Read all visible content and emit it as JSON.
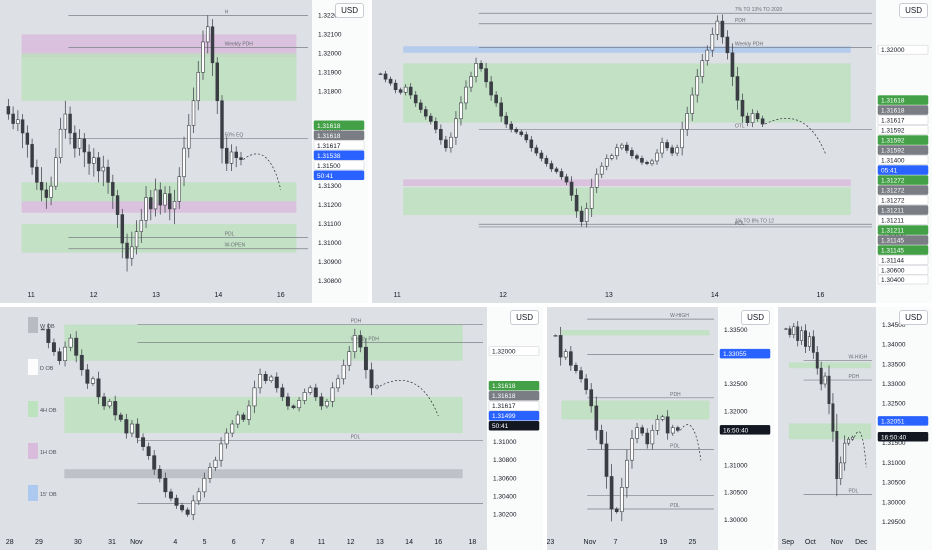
{
  "colors": {
    "background": "#dde0e5",
    "separator": "#ffffff",
    "candle_body": "#3a3d44",
    "candle_wick": "#4a4d55",
    "ob_green": "#b9e2b9",
    "ob_pink": "#d8b7d9",
    "ob_gray": "#b4b7bd",
    "ob_blue": "#a8c6ef",
    "badge_green": "#43a047",
    "badge_gray": "#7a7d84",
    "badge_blue": "#2962ff",
    "badge_black": "#131722",
    "badge_white": "#ffffff"
  },
  "chart_data": [
    {
      "id": "p1",
      "type": "candlestick",
      "currency": "USD",
      "ylim": [
        1.308,
        1.3226
      ],
      "yticks": [
        "1.32200",
        "1.32100",
        "1.32000",
        "1.31900",
        "1.31800",
        "1.31600",
        "1.31400",
        "1.31300",
        "1.31200",
        "1.31100",
        "1.31000",
        "1.30900",
        "1.30800"
      ],
      "xticks": [
        {
          "label": "11",
          "pos": 0.1
        },
        {
          "label": "12",
          "pos": 0.3
        },
        {
          "label": "13",
          "pos": 0.5
        },
        {
          "label": "14",
          "pos": 0.7
        },
        {
          "label": "16",
          "pos": 0.9
        }
      ],
      "candles": [
        [
          1.3172,
          1.3168,
          1.3176,
          1.3165
        ],
        [
          1.3168,
          1.3163,
          1.3172,
          1.316
        ],
        [
          1.3163,
          1.3165,
          1.317,
          1.3159
        ],
        [
          1.3165,
          1.3158,
          1.3168,
          1.315
        ],
        [
          1.3158,
          1.3152,
          1.3162,
          1.3145
        ],
        [
          1.3152,
          1.314,
          1.3155,
          1.3136
        ],
        [
          1.314,
          1.3132,
          1.3144,
          1.3128
        ],
        [
          1.3132,
          1.3128,
          1.314,
          1.3122
        ],
        [
          1.3128,
          1.3124,
          1.3132,
          1.3118
        ],
        [
          1.3124,
          1.313,
          1.3135,
          1.312
        ],
        [
          1.313,
          1.3145,
          1.315,
          1.3128
        ],
        [
          1.3145,
          1.316,
          1.3166,
          1.3142
        ],
        [
          1.316,
          1.3168,
          1.3175,
          1.3155
        ],
        [
          1.3168,
          1.3158,
          1.3172,
          1.3152
        ],
        [
          1.3158,
          1.315,
          1.3162,
          1.3145
        ],
        [
          1.315,
          1.3155,
          1.316,
          1.3146
        ],
        [
          1.3155,
          1.3148,
          1.3158,
          1.314
        ],
        [
          1.3148,
          1.3142,
          1.3152,
          1.3136
        ],
        [
          1.3142,
          1.3145,
          1.315,
          1.3135
        ],
        [
          1.3145,
          1.3138,
          1.3148,
          1.3132
        ],
        [
          1.3138,
          1.314,
          1.3146,
          1.313
        ],
        [
          1.314,
          1.3132,
          1.3144,
          1.3126
        ],
        [
          1.3132,
          1.3125,
          1.3136,
          1.3118
        ],
        [
          1.3125,
          1.3115,
          1.3128,
          1.3108
        ],
        [
          1.3115,
          1.31,
          1.3118,
          1.3092
        ],
        [
          1.31,
          1.3092,
          1.3105,
          1.3085
        ],
        [
          1.3092,
          1.3098,
          1.3106,
          1.3088
        ],
        [
          1.3098,
          1.3106,
          1.3112,
          1.3094
        ],
        [
          1.3106,
          1.3112,
          1.3118,
          1.31
        ],
        [
          1.3112,
          1.3124,
          1.313,
          1.3108
        ],
        [
          1.3124,
          1.3118,
          1.3128,
          1.3112
        ],
        [
          1.3118,
          1.3128,
          1.3134,
          1.3114
        ],
        [
          1.3128,
          1.312,
          1.3132,
          1.3115
        ],
        [
          1.312,
          1.3126,
          1.313,
          1.3116
        ],
        [
          1.3126,
          1.3118,
          1.313,
          1.3112
        ],
        [
          1.3118,
          1.3122,
          1.3128,
          1.311
        ],
        [
          1.3122,
          1.3135,
          1.314,
          1.3118
        ],
        [
          1.3135,
          1.315,
          1.3156,
          1.313
        ],
        [
          1.315,
          1.3162,
          1.3168,
          1.3145
        ],
        [
          1.3162,
          1.3175,
          1.3182,
          1.3158
        ],
        [
          1.3175,
          1.319,
          1.3196,
          1.317
        ],
        [
          1.319,
          1.3206,
          1.3212,
          1.3186
        ],
        [
          1.3206,
          1.3214,
          1.322,
          1.32
        ],
        [
          1.3214,
          1.3195,
          1.3218,
          1.3188
        ],
        [
          1.3195,
          1.3175,
          1.3198,
          1.3168
        ],
        [
          1.3175,
          1.315,
          1.3178,
          1.3142
        ],
        [
          1.315,
          1.3142,
          1.3156,
          1.3138
        ],
        [
          1.3142,
          1.3148,
          1.3152,
          1.3138
        ],
        [
          1.3148,
          1.3145,
          1.3151,
          1.314
        ],
        [
          1.3145,
          1.3144,
          1.3148,
          1.3141
        ]
      ],
      "zones": [
        {
          "y1": 1.3198,
          "y2": 1.321,
          "kind": "pink"
        },
        {
          "y1": 1.3175,
          "y2": 1.32,
          "kind": "green"
        },
        {
          "y1": 1.3116,
          "y2": 1.3122,
          "kind": "pink"
        },
        {
          "y1": 1.3122,
          "y2": 1.3132,
          "kind": "green"
        },
        {
          "y1": 1.3095,
          "y2": 1.311,
          "kind": "green"
        }
      ],
      "levels": [
        {
          "y": 1.322,
          "label": "H"
        },
        {
          "y": 1.3203,
          "label": "Weekly PDH"
        },
        {
          "y": 1.3155,
          "label": "50% EQ"
        },
        {
          "y": 1.3103,
          "label": "PDL"
        },
        {
          "y": 1.3097,
          "label": "W-OPEN"
        }
      ],
      "badges": [
        {
          "text": "1.31618",
          "color": "badge_green",
          "price": 1.31618
        },
        {
          "text": "1.31618",
          "color": "badge_gray",
          "price": 1.31618
        },
        {
          "text": "1.31617",
          "color": "badge_white",
          "price": 1.31617
        },
        {
          "text": "1.31538",
          "color": "badge_blue",
          "price": 1.31538
        },
        {
          "text": "1.31500",
          "color": "badge_white",
          "price": 1.315
        },
        {
          "text": "50:41",
          "color": "badge_blue",
          "price": 1.315
        }
      ]
    },
    {
      "id": "p2",
      "type": "candlestick",
      "currency": "USD",
      "ylim": [
        1.3025,
        1.3235
      ],
      "yticks": [
        "1.32000",
        "1.31400",
        "1.30600",
        "1.30400"
      ],
      "xticks": [
        {
          "label": "11",
          "pos": 0.05
        },
        {
          "label": "12",
          "pos": 0.26
        },
        {
          "label": "13",
          "pos": 0.47
        },
        {
          "label": "14",
          "pos": 0.68
        },
        {
          "label": "16",
          "pos": 0.89
        }
      ],
      "close": [
        1.3182,
        1.3178,
        1.3175,
        1.317,
        1.3168,
        1.3172,
        1.3166,
        1.316,
        1.3155,
        1.315,
        1.3146,
        1.314,
        1.3132,
        1.3126,
        1.3134,
        1.3148,
        1.316,
        1.3172,
        1.318,
        1.319,
        1.3186,
        1.3176,
        1.3166,
        1.316,
        1.315,
        1.3144,
        1.314,
        1.3138,
        1.3136,
        1.3132,
        1.3126,
        1.3122,
        1.3118,
        1.3114,
        1.311,
        1.3108,
        1.3104,
        1.31,
        1.309,
        1.3078,
        1.307,
        1.308,
        1.3096,
        1.3106,
        1.3112,
        1.3118,
        1.312,
        1.3126,
        1.3128,
        1.3124,
        1.312,
        1.3118,
        1.3115,
        1.3114,
        1.3116,
        1.3122,
        1.313,
        1.3126,
        1.3122,
        1.3126,
        1.314,
        1.3152,
        1.3166,
        1.318,
        1.3192,
        1.32,
        1.3212,
        1.3222,
        1.321,
        1.3198,
        1.318,
        1.3162,
        1.315,
        1.3145,
        1.3152,
        1.3148,
        1.3144
      ],
      "zones": [
        {
          "y1": 1.3198,
          "y2": 1.3203,
          "kind": "blue"
        },
        {
          "y1": 1.3145,
          "y2": 1.319,
          "kind": "green"
        },
        {
          "y1": 1.3097,
          "y2": 1.3102,
          "kind": "pink"
        },
        {
          "y1": 1.3075,
          "y2": 1.3096,
          "kind": "green"
        }
      ],
      "levels": [
        {
          "y": 1.3228,
          "label": "7% TO 13% TO 2020"
        },
        {
          "y": 1.322,
          "label": "PDH"
        },
        {
          "y": 1.3202,
          "label": "Weekly PDH"
        },
        {
          "y": 1.314,
          "label": "OTL"
        },
        {
          "y": 1.3068,
          "label": "1% TO 8% TO 12"
        },
        {
          "y": 1.3066,
          "label": "PDL"
        }
      ],
      "badges": [
        {
          "text": "1.32000",
          "color": "badge_white",
          "price": 1.32
        },
        {
          "text": "1.31618",
          "color": "badge_green",
          "price": 1.31618
        },
        {
          "text": "1.31618",
          "color": "badge_gray",
          "price": 1.31618
        },
        {
          "text": "1.31617",
          "color": "badge_white",
          "price": 1.31617
        },
        {
          "text": "1.31592",
          "color": "badge_white",
          "price": 1.31592
        },
        {
          "text": "1.31592",
          "color": "badge_green",
          "price": 1.31592
        },
        {
          "text": "1.31592",
          "color": "badge_gray",
          "price": 1.31592
        },
        {
          "text": "1.31400",
          "color": "badge_white",
          "price": 1.314
        },
        {
          "text": "05:41",
          "color": "badge_blue",
          "price": 1.3141
        },
        {
          "text": "1.31272",
          "color": "badge_green",
          "price": 1.31272
        },
        {
          "text": "1.31272",
          "color": "badge_gray",
          "price": 1.31272
        },
        {
          "text": "1.31272",
          "color": "badge_white",
          "price": 1.31272
        },
        {
          "text": "1.31211",
          "color": "badge_gray",
          "price": 1.31211
        },
        {
          "text": "1.31211",
          "color": "badge_white",
          "price": 1.31211
        },
        {
          "text": "1.31211",
          "color": "badge_green",
          "price": 1.31211
        },
        {
          "text": "1.31145",
          "color": "badge_gray",
          "price": 1.31145
        },
        {
          "text": "1.31145",
          "color": "badge_green",
          "price": 1.31145
        },
        {
          "text": "1.31144",
          "color": "badge_white",
          "price": 1.31144
        },
        {
          "text": "1.30600",
          "color": "badge_white",
          "price": 1.306
        },
        {
          "text": "1.30400",
          "color": "badge_white",
          "price": 1.304
        }
      ]
    },
    {
      "id": "p3",
      "type": "candlestick",
      "currency": "USD",
      "ylim": [
        1.3005,
        1.3245
      ],
      "yticks": [
        "1.32000",
        "1.31200",
        "1.31000",
        "1.30800",
        "1.30600",
        "1.30400",
        "1.30200"
      ],
      "xticks": [
        {
          "label": "28",
          "pos": 0.02
        },
        {
          "label": "29",
          "pos": 0.08
        },
        {
          "label": "30",
          "pos": 0.16
        },
        {
          "label": "31",
          "pos": 0.23
        },
        {
          "label": "Nov",
          "pos": 0.28
        },
        {
          "label": "4",
          "pos": 0.36
        },
        {
          "label": "5",
          "pos": 0.42
        },
        {
          "label": "6",
          "pos": 0.48
        },
        {
          "label": "7",
          "pos": 0.54
        },
        {
          "label": "8",
          "pos": 0.6
        },
        {
          "label": "11",
          "pos": 0.66
        },
        {
          "label": "12",
          "pos": 0.72
        },
        {
          "label": "13",
          "pos": 0.78
        },
        {
          "label": "14",
          "pos": 0.84
        },
        {
          "label": "16",
          "pos": 0.9
        },
        {
          "label": "18",
          "pos": 0.97
        }
      ],
      "legend": [
        "W OB",
        "D OB",
        "4H OB",
        "1H OB",
        "15' OB"
      ],
      "close": [
        1.3225,
        1.321,
        1.32,
        1.319,
        1.3205,
        1.3215,
        1.3196,
        1.318,
        1.3165,
        1.317,
        1.315,
        1.314,
        1.3145,
        1.313,
        1.3125,
        1.311,
        1.312,
        1.3105,
        1.3095,
        1.3085,
        1.307,
        1.306,
        1.3045,
        1.3038,
        1.303,
        1.3025,
        1.302,
        1.3035,
        1.3045,
        1.306,
        1.3072,
        1.308,
        1.3098,
        1.311,
        1.312,
        1.313,
        1.3125,
        1.314,
        1.316,
        1.3175,
        1.3168,
        1.3172,
        1.316,
        1.315,
        1.314,
        1.3138,
        1.3146,
        1.3155,
        1.316,
        1.315,
        1.314,
        1.3145,
        1.316,
        1.317,
        1.3185,
        1.32,
        1.3218,
        1.3205,
        1.318,
        1.316,
        1.3162
      ],
      "zones": [
        {
          "y1": 1.319,
          "y2": 1.323,
          "kind": "green"
        },
        {
          "y1": 1.311,
          "y2": 1.315,
          "kind": "green"
        },
        {
          "y1": 1.306,
          "y2": 1.307,
          "kind": "gray"
        }
      ],
      "levels": [
        {
          "y": 1.323,
          "label": "PDH"
        },
        {
          "y": 1.321,
          "label": "Weekly PDH"
        },
        {
          "y": 1.3102,
          "label": "PDL"
        },
        {
          "y": 1.3032,
          "label": ""
        }
      ],
      "badges": [
        {
          "text": "1.32000",
          "color": "badge_white",
          "price": 1.32
        },
        {
          "text": "1.31618",
          "color": "badge_green",
          "price": 1.31618
        },
        {
          "text": "1.31618",
          "color": "badge_gray",
          "price": 1.31618
        },
        {
          "text": "1.31617",
          "color": "badge_white",
          "price": 1.31617
        },
        {
          "text": "1.31499",
          "color": "badge_blue",
          "price": 1.31499
        },
        {
          "text": "50:41",
          "color": "badge_black",
          "price": 1.315
        }
      ]
    },
    {
      "id": "p4",
      "type": "candlestick",
      "currency": "USD",
      "ylim": [
        1.2985,
        1.3385
      ],
      "yticks": [
        "1.33500",
        "1.33055",
        "1.32500",
        "1.32000",
        "1.31000",
        "1.30500",
        "1.30000"
      ],
      "xticks": [
        {
          "label": "23",
          "pos": 0.02
        },
        {
          "label": "Nov",
          "pos": 0.25
        },
        {
          "label": "7",
          "pos": 0.4
        },
        {
          "label": "19",
          "pos": 0.68
        },
        {
          "label": "25",
          "pos": 0.85
        }
      ],
      "close": [
        1.334,
        1.33,
        1.331,
        1.3285,
        1.3275,
        1.326,
        1.324,
        1.321,
        1.3165,
        1.314,
        1.308,
        1.302,
        1.3015,
        1.306,
        1.311,
        1.315,
        1.317,
        1.316,
        1.314,
        1.3165,
        1.3185,
        1.319,
        1.316,
        1.317,
        1.3165
      ],
      "zones": [
        {
          "y1": 1.334,
          "y2": 1.335,
          "kind": "green"
        },
        {
          "y1": 1.3185,
          "y2": 1.322,
          "kind": "green"
        }
      ],
      "levels": [
        {
          "y": 1.337,
          "label": "W-HIGH"
        },
        {
          "y": 1.3305,
          "label": ""
        },
        {
          "y": 1.3225,
          "label": "PDH"
        },
        {
          "y": 1.313,
          "label": "PDL"
        },
        {
          "y": 1.3045,
          "label": ""
        },
        {
          "y": 1.302,
          "label": "PDL"
        }
      ],
      "badges": [
        {
          "text": "1.33055",
          "color": "badge_blue",
          "price": 1.33055
        },
        {
          "text": "16:50:40",
          "color": "badge_black",
          "price": 1.3165
        }
      ]
    },
    {
      "id": "p5",
      "type": "candlestick",
      "currency": "USD",
      "ylim": [
        1.2935,
        1.3485
      ],
      "yticks": [
        "1.34500",
        "1.34000",
        "1.33500",
        "1.33000",
        "1.32500",
        "1.32051",
        "1.31500",
        "1.31000",
        "1.30500",
        "1.30000",
        "1.29500"
      ],
      "xticks": [
        {
          "label": "Sep",
          "pos": 0.1
        },
        {
          "label": "Oct",
          "pos": 0.33
        },
        {
          "label": "Nov",
          "pos": 0.6
        },
        {
          "label": "Dec",
          "pos": 0.85
        }
      ],
      "close": [
        1.344,
        1.3425,
        1.3445,
        1.341,
        1.3435,
        1.3395,
        1.342,
        1.338,
        1.334,
        1.33,
        1.332,
        1.325,
        1.318,
        1.306,
        1.31,
        1.315,
        1.316,
        1.3165
      ],
      "zones": [
        {
          "y1": 1.334,
          "y2": 1.3355,
          "kind": "green"
        },
        {
          "y1": 1.316,
          "y2": 1.32,
          "kind": "green"
        }
      ],
      "levels": [
        {
          "y": 1.336,
          "label": "W-HIGH"
        },
        {
          "y": 1.331,
          "label": "PDH"
        },
        {
          "y": 1.302,
          "label": "PDL"
        }
      ],
      "badges": [
        {
          "text": "1.32051",
          "color": "badge_blue",
          "price": 1.32051
        },
        {
          "text": "16:50:40",
          "color": "badge_black",
          "price": 1.3165
        }
      ]
    }
  ]
}
